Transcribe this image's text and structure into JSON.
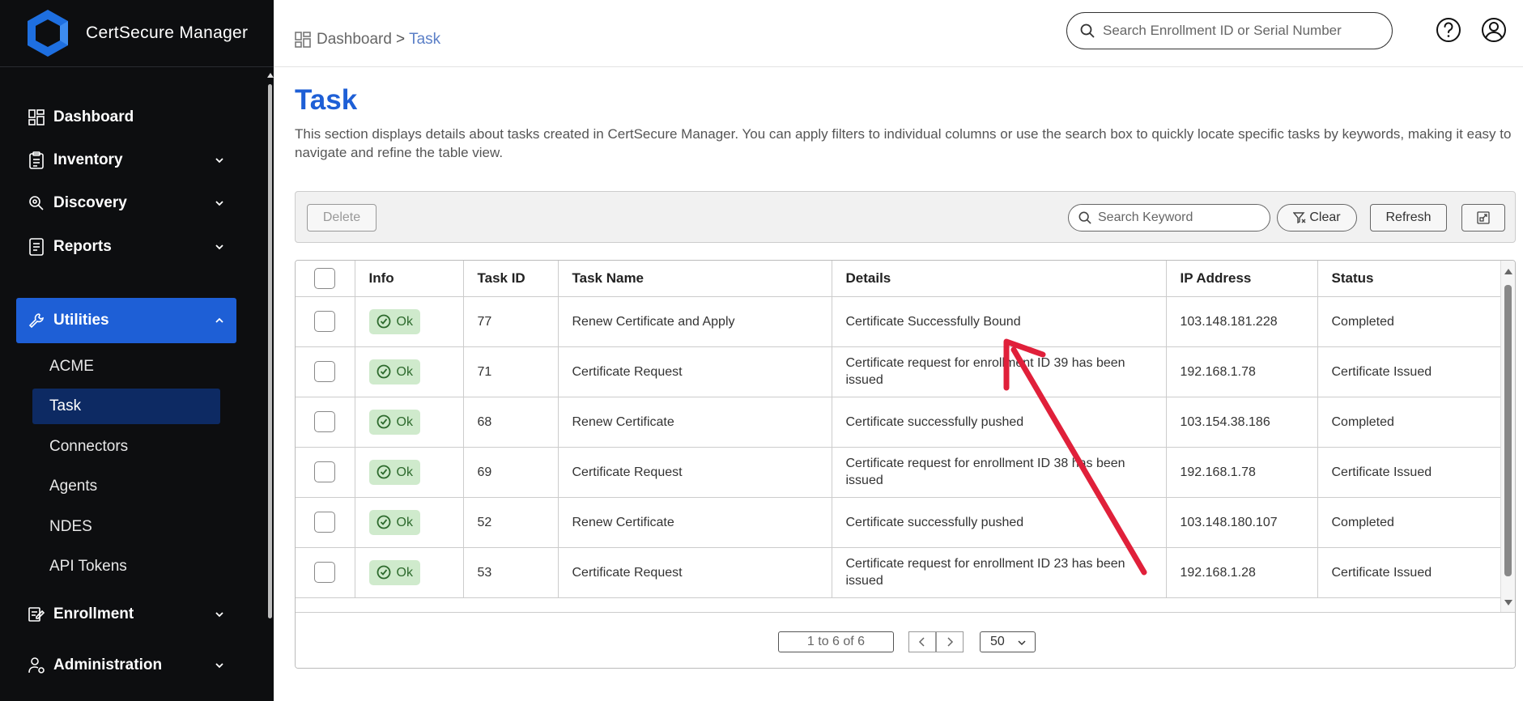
{
  "app": {
    "name": "CertSecure Manager"
  },
  "sidebar": {
    "items": [
      {
        "label": "Dashboard",
        "icon": "dashboard-icon"
      },
      {
        "label": "Inventory",
        "icon": "clipboard-icon"
      },
      {
        "label": "Discovery",
        "icon": "search-gear-icon"
      },
      {
        "label": "Reports",
        "icon": "report-icon"
      },
      {
        "label": "Utilities",
        "icon": "wrench-icon",
        "active": true
      },
      {
        "label": "Enrollment",
        "icon": "document-edit-icon"
      },
      {
        "label": "Administration",
        "icon": "user-gear-icon"
      }
    ],
    "subitems": [
      {
        "label": "ACME"
      },
      {
        "label": "Task",
        "active": true
      },
      {
        "label": "Connectors"
      },
      {
        "label": "Agents"
      },
      {
        "label": "NDES"
      },
      {
        "label": "API Tokens"
      }
    ]
  },
  "header": {
    "breadcrumb": {
      "root": "Dashboard",
      "separator": ">",
      "current": "Task"
    },
    "search_placeholder": "Search Enrollment ID or Serial Number"
  },
  "page": {
    "title": "Task",
    "description": "This section displays details about tasks created in CertSecure Manager. You can apply filters to individual columns or use the search box to quickly locate specific tasks by keywords, making it easy to navigate and refine the table view."
  },
  "toolbar": {
    "delete_label": "Delete",
    "keyword_placeholder": "Search Keyword",
    "clear_label": "Clear",
    "refresh_label": "Refresh"
  },
  "table": {
    "columns": [
      "Info",
      "Task ID",
      "Task Name",
      "Details",
      "IP Address",
      "Status"
    ],
    "rows": [
      {
        "info": "Ok",
        "task_id": "77",
        "task_name": "Renew Certificate and Apply",
        "details": "Certificate Successfully Bound",
        "ip": "103.148.181.228",
        "status": "Completed"
      },
      {
        "info": "Ok",
        "task_id": "71",
        "task_name": "Certificate Request",
        "details": "Certificate request for enrollment ID 39 has been issued",
        "ip": "192.168.1.78",
        "status": "Certificate Issued"
      },
      {
        "info": "Ok",
        "task_id": "68",
        "task_name": "Renew Certificate",
        "details": "Certificate successfully pushed",
        "ip": "103.154.38.186",
        "status": "Completed"
      },
      {
        "info": "Ok",
        "task_id": "69",
        "task_name": "Certificate Request",
        "details": "Certificate request for enrollment ID 38 has been issued",
        "ip": "192.168.1.78",
        "status": "Certificate Issued"
      },
      {
        "info": "Ok",
        "task_id": "52",
        "task_name": "Renew Certificate",
        "details": "Certificate successfully pushed",
        "ip": "103.148.180.107",
        "status": "Completed"
      },
      {
        "info": "Ok",
        "task_id": "53",
        "task_name": "Certificate Request",
        "details": "Certificate request for enrollment ID 23 has been issued",
        "ip": "192.168.1.28",
        "status": "Certificate Issued"
      }
    ]
  },
  "pagination": {
    "info": "1 to 6 of 6",
    "page_size": "50"
  },
  "colors": {
    "accent": "#1e5fd6",
    "sidebar_bg": "#0d0e10",
    "ok_bg": "#cfeacc",
    "annotation": "#e0203a"
  }
}
